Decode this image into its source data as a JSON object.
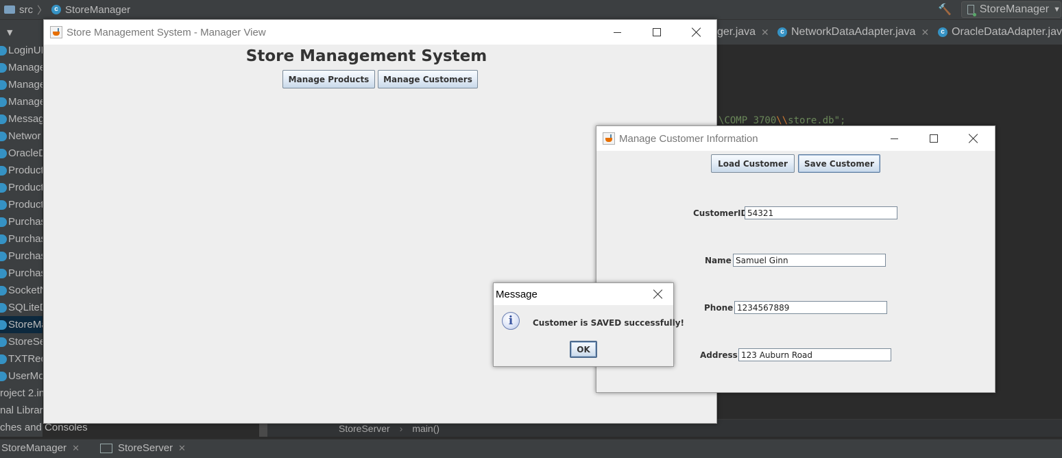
{
  "ide": {
    "breadcrumb": [
      "src",
      "StoreManager"
    ],
    "run_config": "StoreManager",
    "editor_tabs": [
      "ger.java",
      "NetworkDataAdapter.java",
      "OracleDataAdapter.java"
    ],
    "project_items": [
      "LoginUI",
      "Manage",
      "Manage",
      "Manage",
      "Messag",
      "Networ",
      "OracleD",
      "Product",
      "Product",
      "Product",
      "Purchas",
      "Purchas",
      "Purchas",
      "Purchas",
      "SocketN",
      "SQLiteD",
      "StoreMa",
      "StoreSe",
      "TXTRec",
      "UserMo"
    ],
    "project_overflow": [
      "roject 2.in",
      "nal Librar",
      "ches and Consoles"
    ],
    "code_fragment": {
      "a": "\\COMP 3700",
      "b": "\\\\",
      "c": "store.db\";"
    },
    "editor_crumbs": [
      "StoreServer",
      "main()"
    ],
    "bottom_tabs": [
      "StoreManager",
      "StoreServer"
    ],
    "colors": {
      "bg": "#2b2b2b",
      "panel": "#3c3f41",
      "selection": "#0d293e",
      "string": "#6a8759"
    }
  },
  "main_window": {
    "title": "Store Management System - Manager View",
    "heading": "Store Management System",
    "buttons": {
      "products": "Manage Products",
      "customers": "Manage Customers"
    }
  },
  "customer_window": {
    "title": "Manage Customer Information",
    "buttons": {
      "load": "Load Customer",
      "save": "Save Customer"
    },
    "fields": {
      "customer_id": {
        "label": "CustomerID",
        "value": "54321"
      },
      "name": {
        "label": "Name",
        "value": "Samuel Ginn"
      },
      "phone": {
        "label": "Phone",
        "value": "1234567889"
      },
      "address": {
        "label": "Address",
        "value": "123 Auburn Road"
      }
    }
  },
  "message_dialog": {
    "title": "Message",
    "icon": "info-icon",
    "text": "Customer is SAVED successfully!",
    "ok": "OK"
  }
}
